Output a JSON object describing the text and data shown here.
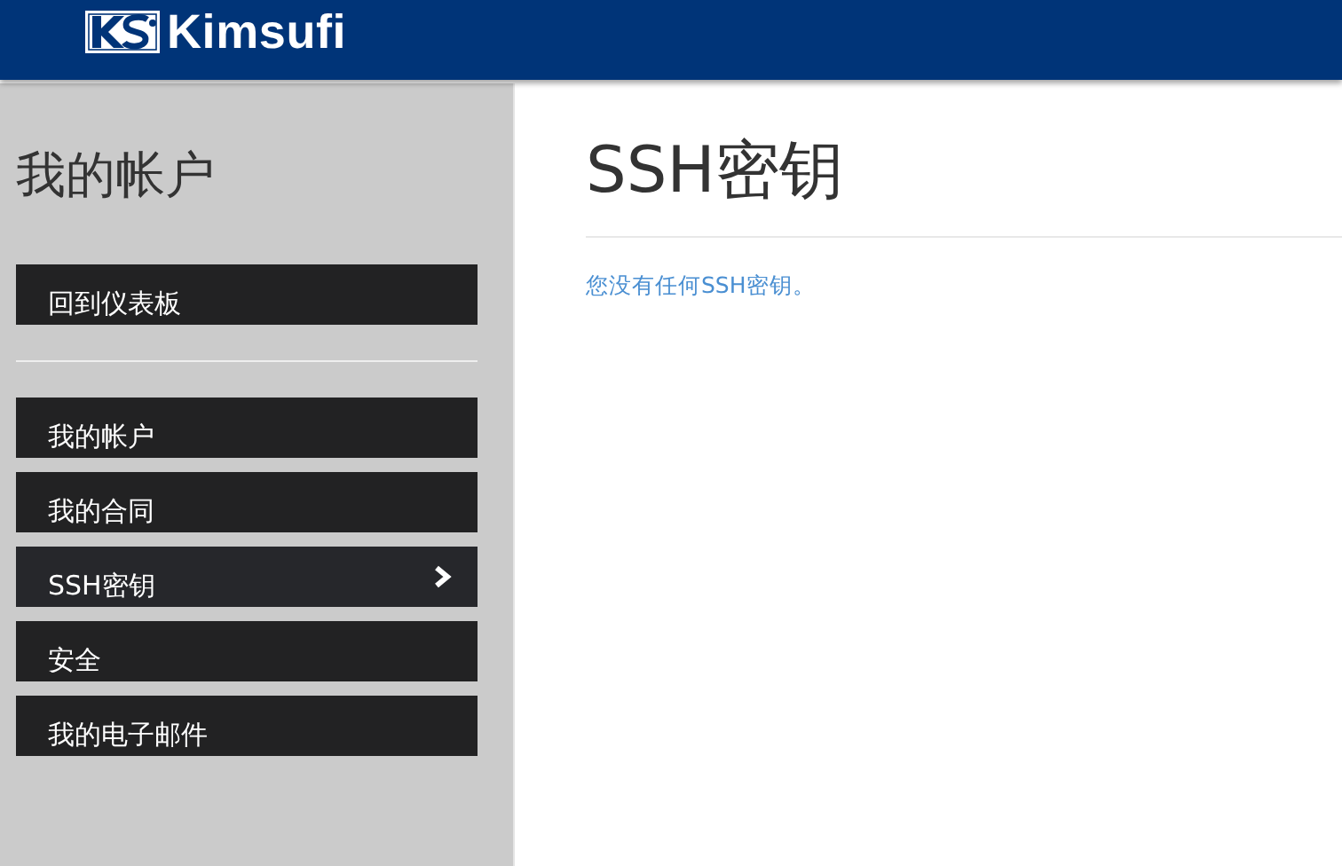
{
  "header": {
    "brand": "Kimsufi"
  },
  "sidebar": {
    "title": "我的帐户",
    "top_item": {
      "label": "回到仪表板",
      "selected": false
    },
    "items": [
      {
        "label": "我的帐户",
        "selected": false
      },
      {
        "label": "我的合同",
        "selected": false
      },
      {
        "label": "SSH密钥",
        "selected": true
      },
      {
        "label": "安全",
        "selected": false
      },
      {
        "label": "我的电子邮件",
        "selected": false
      }
    ]
  },
  "main": {
    "title": "SSH密钥",
    "message": "您没有任何SSH密钥。"
  }
}
